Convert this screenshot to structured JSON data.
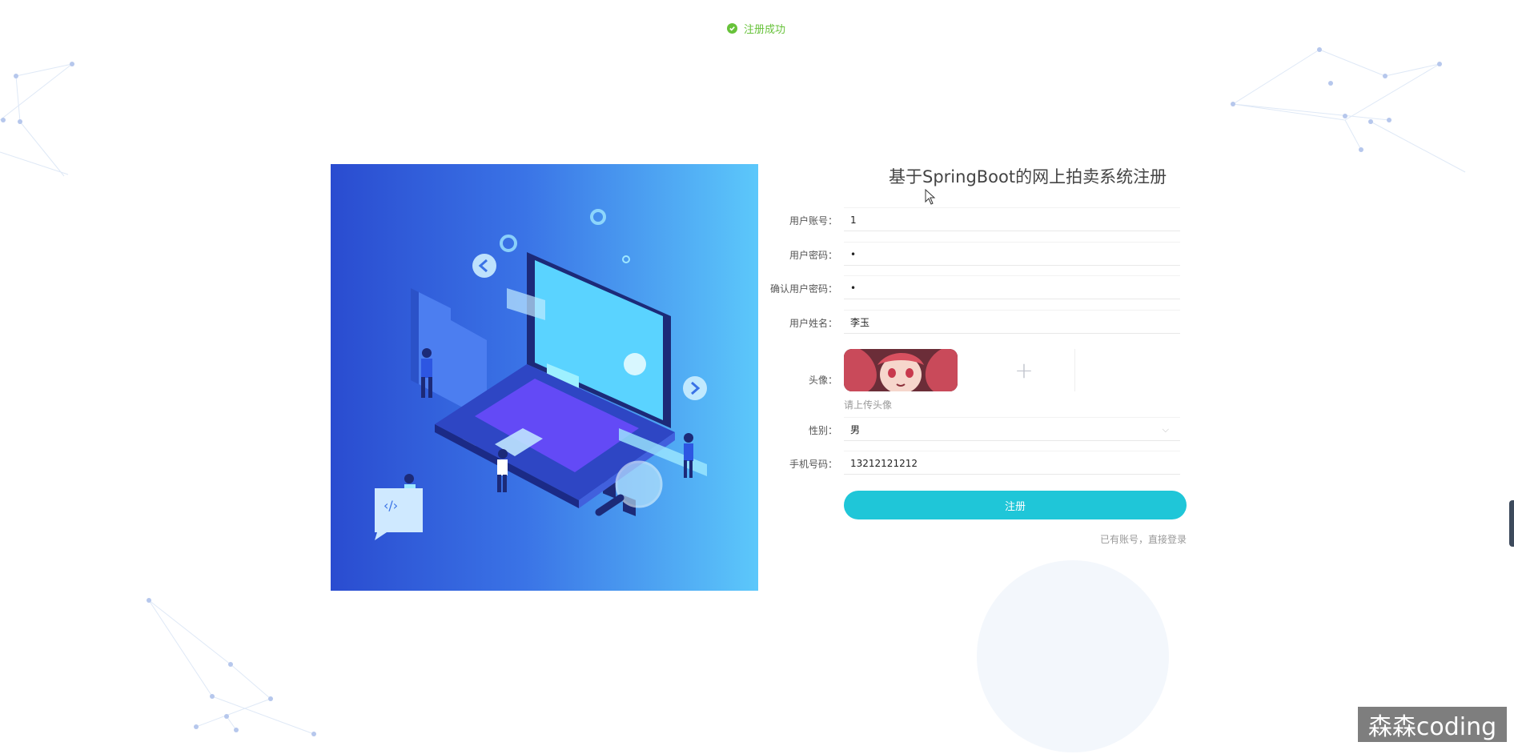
{
  "toast": {
    "message": "注册成功",
    "color": "#67c23a"
  },
  "form": {
    "title": "基于SpringBoot的网上拍卖系统注册",
    "fields": [
      {
        "label": "用户账号：",
        "value": "1"
      },
      {
        "label": "用户密码：",
        "value": "•"
      },
      {
        "label": "确认用户密码：",
        "value": "•"
      },
      {
        "label": "用户姓名：",
        "value": "李玉"
      }
    ],
    "avatar": {
      "label": "头像：",
      "hint": "请上传头像",
      "upload_icon": "plus-icon"
    },
    "gender": {
      "label": "性别：",
      "value": "男"
    },
    "phone": {
      "label": "手机号码：",
      "value": "13212121212"
    },
    "submit_label": "注册",
    "login_link": "已有账号，直接登录"
  },
  "colors": {
    "accent": "#1fc6d8",
    "success": "#67c23a",
    "illustration_start": "#2a4cd0",
    "illustration_end": "#5cc8fb"
  },
  "watermark": "森森coding"
}
